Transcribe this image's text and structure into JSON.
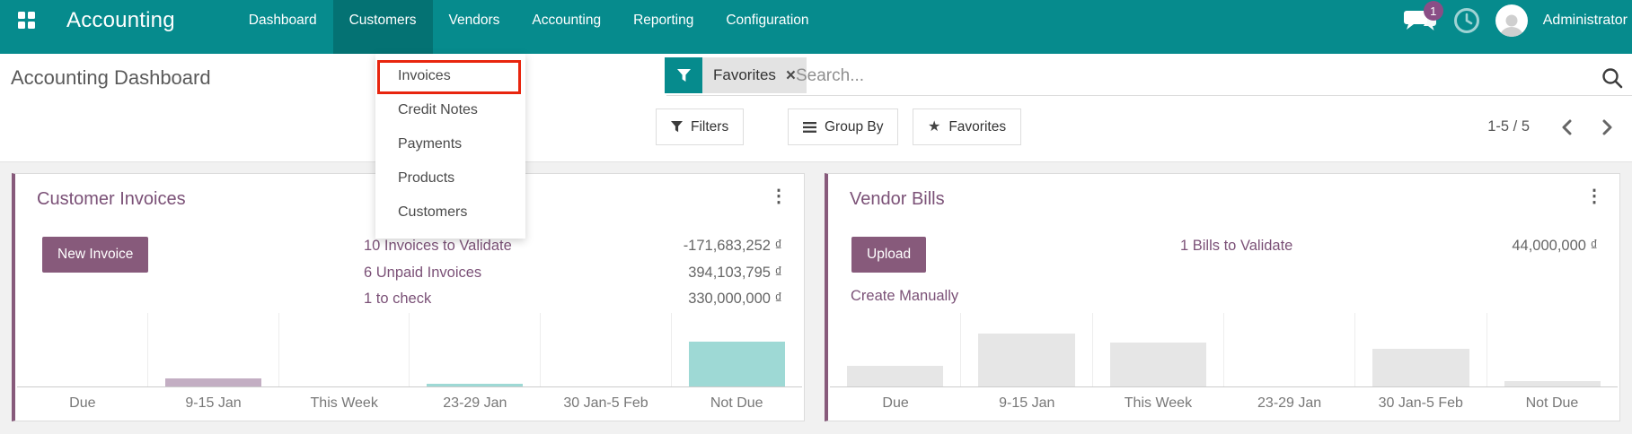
{
  "navbar": {
    "brand": "Accounting",
    "items": [
      {
        "label": "Dashboard"
      },
      {
        "label": "Customers"
      },
      {
        "label": "Vendors"
      },
      {
        "label": "Accounting"
      },
      {
        "label": "Reporting"
      },
      {
        "label": "Configuration"
      }
    ],
    "systray": {
      "message_badge": "1",
      "user_name": "Administrator"
    }
  },
  "customers_menu": {
    "items": [
      {
        "label": "Invoices"
      },
      {
        "label": "Credit Notes"
      },
      {
        "label": "Payments"
      },
      {
        "label": "Products"
      },
      {
        "label": "Customers"
      }
    ],
    "highlighted_item": "Invoices"
  },
  "page": {
    "title": "Accounting Dashboard"
  },
  "search": {
    "facet": "Favorites",
    "facet_remove": "×",
    "placeholder": "Search..."
  },
  "controls": {
    "filters": "Filters",
    "group_by": "Group By",
    "favorites": "Favorites"
  },
  "pager": {
    "range": "1-5 / 5"
  },
  "cards": [
    {
      "title": "Customer Invoices",
      "button": "New Invoice",
      "rows": [
        {
          "link": "10 Invoices to Validate",
          "value": "-171,683,252 ₫"
        },
        {
          "link": "6 Unpaid Invoices",
          "value": "394,103,795 ₫"
        },
        {
          "link": "1 to check",
          "value": "330,000,000 ₫"
        }
      ]
    },
    {
      "title": "Vendor Bills",
      "button": "Upload",
      "secondary_link": "Create Manually",
      "rows": [
        {
          "link": "1 Bills to Validate",
          "value": "44,000,000 ₫"
        }
      ]
    }
  ],
  "chart_data": [
    {
      "type": "bar",
      "card": "Customer Invoices",
      "categories": [
        "Due",
        "9-15 Jan",
        "This Week",
        "23-29 Jan",
        "30 Jan-5 Feb",
        "Not Due"
      ],
      "values": [
        0,
        11,
        0,
        4,
        0,
        61
      ],
      "unit": "relative-bar-height-percent-of-plot (no y axis shown)",
      "colors": [
        "#e6e6e6",
        "#c3aec3",
        "#e6e6e6",
        "#9ed9d5",
        "#e6e6e6",
        "#9ed9d5"
      ],
      "grid": "vertical column separators, baseline axis only"
    },
    {
      "type": "bar",
      "card": "Vendor Bills",
      "categories": [
        "Due",
        "9-15 Jan",
        "This Week",
        "23-29 Jan",
        "30 Jan-5 Feb",
        "Not Due"
      ],
      "values": [
        28,
        72,
        60,
        0,
        51,
        7
      ],
      "unit": "relative-bar-height-percent-of-plot (no y axis shown)",
      "colors": [
        "#e6e6e6",
        "#e6e6e6",
        "#e6e6e6",
        "#e6e6e6",
        "#e6e6e6",
        "#e6e6e6"
      ],
      "grid": "vertical column separators, baseline axis only"
    }
  ],
  "colors": {
    "navbar_teal": "#068b8d",
    "active_menu_teal": "#0a7274",
    "odoo_purple": "#875A7B",
    "link_purple": "#7b5177",
    "highlight_red": "#e8250e",
    "bar_teal": "#9ed9d5",
    "bar_mauve": "#c3aec3",
    "bar_gray": "#e6e6e6"
  }
}
